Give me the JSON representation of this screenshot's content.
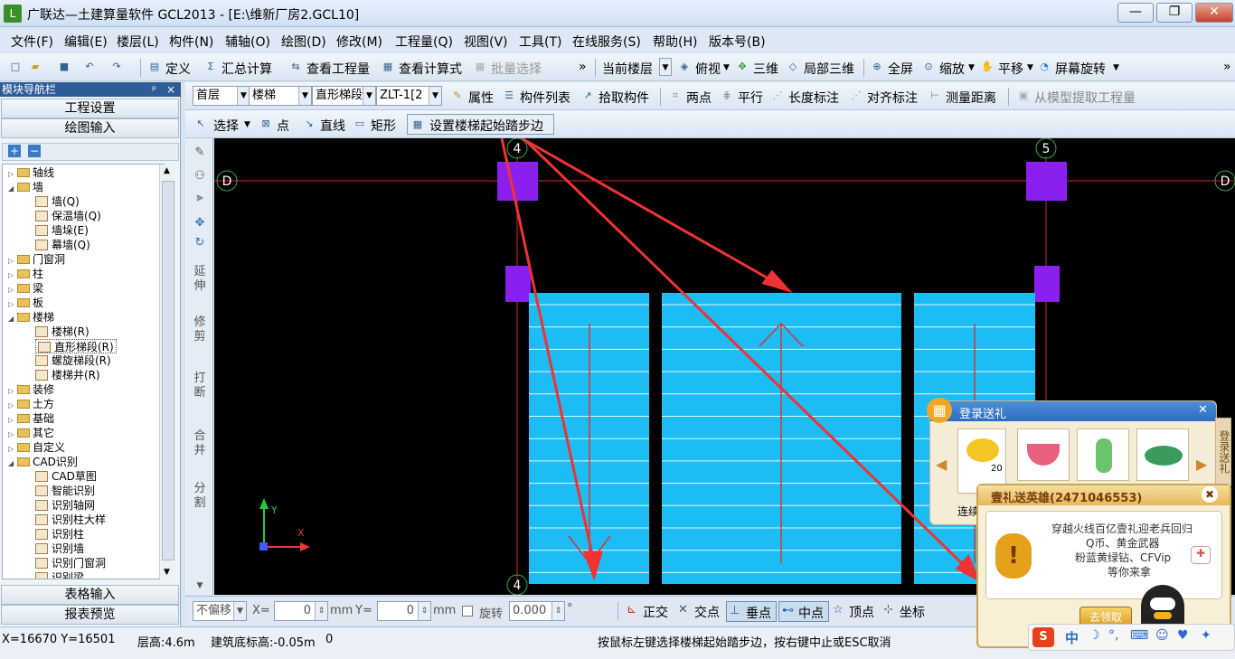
{
  "window": {
    "title": "广联达—土建算量软件 GCL2013 - [E:\\维新厂房2.GCL10]",
    "min": "—",
    "max": "❐",
    "close": "✕"
  },
  "menu": [
    "文件(F)",
    "编辑(E)",
    "楼层(L)",
    "构件(N)",
    "辅轴(O)",
    "绘图(D)",
    "修改(M)",
    "工程量(Q)",
    "视图(V)",
    "工具(T)",
    "在线服务(S)",
    "帮助(H)",
    "版本号(B)"
  ],
  "toolbar1": {
    "define": "定义",
    "sum": "汇总计算",
    "view_qty": "查看工程量",
    "view_formula": "查看计算式",
    "batch_select": "批量选择",
    "current_floor": "当前楼层",
    "top_view": "俯视",
    "three_d": "三维",
    "local_3d": "局部三维",
    "fullscreen": "全屏",
    "zoom": "缩放",
    "pan": "平移",
    "rotate": "屏幕旋转"
  },
  "toolbar2": {
    "floor": "首层",
    "type": "楼梯",
    "subtype": "直形梯段",
    "element": "ZLT-1[2",
    "properties": "属性",
    "list": "构件列表",
    "pick": "拾取构件",
    "two_points": "两点",
    "parallel": "平行",
    "length_dim": "长度标注",
    "align_dim": "对齐标注",
    "measure": "测量距离",
    "extract": "从模型提取工程量"
  },
  "toolbar3": {
    "select": "选择",
    "point": "点",
    "line": "直线",
    "rect": "矩形",
    "set_edge": "设置楼梯起始踏步边"
  },
  "panel": {
    "title": "模块导航栏",
    "pin": "ᵖ",
    "close": "×",
    "project_settings": "工程设置",
    "drawing_input": "绘图输入",
    "table_input": "表格输入",
    "report_preview": "报表预览"
  },
  "tree": [
    {
      "label": "轴线",
      "level": 0,
      "type": "folder",
      "tw": "▷"
    },
    {
      "label": "墙",
      "level": 0,
      "type": "folder",
      "tw": "◢"
    },
    {
      "label": "墙(Q)",
      "level": 1,
      "type": "leaf"
    },
    {
      "label": "保温墙(Q)",
      "level": 1,
      "type": "leaf"
    },
    {
      "label": "墙垛(E)",
      "level": 1,
      "type": "leaf"
    },
    {
      "label": "幕墙(Q)",
      "level": 1,
      "type": "leaf"
    },
    {
      "label": "门窗洞",
      "level": 0,
      "type": "folder",
      "tw": "▷"
    },
    {
      "label": "柱",
      "level": 0,
      "type": "folder",
      "tw": "▷"
    },
    {
      "label": "梁",
      "level": 0,
      "type": "folder",
      "tw": "▷"
    },
    {
      "label": "板",
      "level": 0,
      "type": "folder",
      "tw": "▷"
    },
    {
      "label": "楼梯",
      "level": 0,
      "type": "folder",
      "tw": "◢"
    },
    {
      "label": "楼梯(R)",
      "level": 1,
      "type": "leaf"
    },
    {
      "label": "直形梯段(R)",
      "level": 1,
      "type": "leaf",
      "selected": true
    },
    {
      "label": "螺旋梯段(R)",
      "level": 1,
      "type": "leaf"
    },
    {
      "label": "楼梯井(R)",
      "level": 1,
      "type": "leaf"
    },
    {
      "label": "装修",
      "level": 0,
      "type": "folder",
      "tw": "▷"
    },
    {
      "label": "土方",
      "level": 0,
      "type": "folder",
      "tw": "▷"
    },
    {
      "label": "基础",
      "level": 0,
      "type": "folder",
      "tw": "▷"
    },
    {
      "label": "其它",
      "level": 0,
      "type": "folder",
      "tw": "▷"
    },
    {
      "label": "自定义",
      "level": 0,
      "type": "folder",
      "tw": "▷"
    },
    {
      "label": "CAD识别",
      "level": 0,
      "type": "folder",
      "tw": "◢"
    },
    {
      "label": "CAD草图",
      "level": 1,
      "type": "leaf"
    },
    {
      "label": "智能识别",
      "level": 1,
      "type": "leaf"
    },
    {
      "label": "识别轴网",
      "level": 1,
      "type": "leaf"
    },
    {
      "label": "识别柱大样",
      "level": 1,
      "type": "leaf"
    },
    {
      "label": "识别柱",
      "level": 1,
      "type": "leaf"
    },
    {
      "label": "识别墙",
      "level": 1,
      "type": "leaf"
    },
    {
      "label": "识别门窗洞",
      "level": 1,
      "type": "leaf"
    },
    {
      "label": "识别梁",
      "level": 1,
      "type": "leaf"
    }
  ],
  "vtools": [
    "延伸",
    "修剪",
    "打断",
    "合并",
    "分割"
  ],
  "canvas": {
    "axis_4": "4",
    "axis_5": "5",
    "axis_d": "D",
    "ucs_x": "X",
    "ucs_y": "Y"
  },
  "bottom": {
    "no_offset": "不偏移",
    "x_label": "X=",
    "x_val": "0",
    "mm1": "mm",
    "y_label": "Y=",
    "y_val": "0",
    "mm2": "mm",
    "rotate": "旋转",
    "angle": "0.000",
    "deg": "°",
    "ortho": "正交",
    "intersect": "交点",
    "perp": "垂点",
    "mid": "中点",
    "vertex": "顶点",
    "coord": "坐标"
  },
  "status": {
    "coords": "X=16670 Y=16501",
    "floor_height": "层高:4.6m",
    "base_elev": "建筑底标高:-0.05m",
    "zero": "0",
    "hint": "按鼠标左键选择楼梯起始踏步边，按右键中止或ESC取消"
  },
  "popup_gift": {
    "title": "登录送礼",
    "close": "✕",
    "count": "20",
    "caption": "连续",
    "side": "登录送礼"
  },
  "popup_hero": {
    "title": "壹礼送英雄(2471046553)",
    "close": "✖",
    "line1": "穿越火线百亿壹礼迎老兵回归",
    "line2": "Q币、黄金武器",
    "line3": "粉蓝黄绿钻、CFVip",
    "line4": "等你来拿",
    "button": "去领取"
  },
  "ime": {
    "zh": "中",
    "logo": "S"
  }
}
